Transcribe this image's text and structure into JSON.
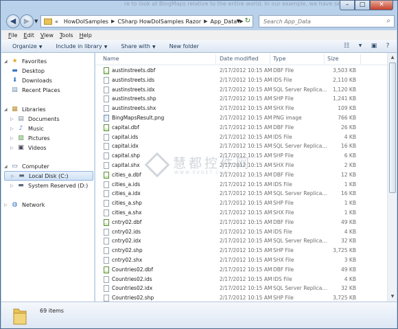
{
  "window": {
    "background_text": "re to look at BingMaps relative to the entire world. In our example, we have set BingMaps"
  },
  "address_bar": {
    "overflow_marker": "«",
    "breadcrumbs": [
      "HowDoISamples",
      "CSharp HowDoISamples Razor",
      "App_Data"
    ]
  },
  "search": {
    "placeholder": "Search App_Data"
  },
  "menu": {
    "items": [
      {
        "accel": "F",
        "rest": "ile"
      },
      {
        "accel": "E",
        "rest": "dit"
      },
      {
        "accel": "V",
        "rest": "iew"
      },
      {
        "accel": "T",
        "rest": "ools"
      },
      {
        "accel": "H",
        "rest": "elp"
      }
    ]
  },
  "toolbar": {
    "organize": "Organize",
    "include": "Include in library",
    "share": "Share with",
    "new_folder": "New folder"
  },
  "nav": {
    "favorites": "Favorites",
    "desktop": "Desktop",
    "downloads": "Downloads",
    "recent": "Recent Places",
    "libraries": "Libraries",
    "documents": "Documents",
    "music": "Music",
    "pictures": "Pictures",
    "videos": "Videos",
    "computer": "Computer",
    "local_disk": "Local Disk (C:)",
    "system_reserved": "System Reserved (D:)",
    "network": "Network"
  },
  "columns": {
    "name": "Name",
    "date": "Date modified",
    "type": "Type",
    "size": "Size"
  },
  "files": [
    {
      "name": "austinstreets.dbf",
      "date": "2/17/2012 10:15 AM",
      "type": "DBF File",
      "size": "3,503 KB",
      "icon": "dbf"
    },
    {
      "name": "austinstreets.ids",
      "date": "2/17/2012 10:15 AM",
      "type": "IDS File",
      "size": "2,110 KB",
      "icon": "file"
    },
    {
      "name": "austinstreets.idx",
      "date": "2/17/2012 10:15 AM",
      "type": "SQL Server Replica...",
      "size": "1,120 KB",
      "icon": "file"
    },
    {
      "name": "austinstreets.shp",
      "date": "2/17/2012 10:15 AM",
      "type": "SHP File",
      "size": "1,241 KB",
      "icon": "file"
    },
    {
      "name": "austinstreets.shx",
      "date": "2/17/2012 10:15 AM",
      "type": "SHX File",
      "size": "109 KB",
      "icon": "file"
    },
    {
      "name": "BingMapsResult.png",
      "date": "2/17/2012 10:15 AM",
      "type": "PNG image",
      "size": "766 KB",
      "icon": "img"
    },
    {
      "name": "capital.dbf",
      "date": "2/17/2012 10:15 AM",
      "type": "DBF File",
      "size": "26 KB",
      "icon": "dbf"
    },
    {
      "name": "capital.ids",
      "date": "2/17/2012 10:15 AM",
      "type": "IDS File",
      "size": "4 KB",
      "icon": "file"
    },
    {
      "name": "capital.idx",
      "date": "2/17/2012 10:15 AM",
      "type": "SQL Server Replica...",
      "size": "16 KB",
      "icon": "file"
    },
    {
      "name": "capital.shp",
      "date": "2/17/2012 10:15 AM",
      "type": "SHP File",
      "size": "6 KB",
      "icon": "file"
    },
    {
      "name": "capital.shx",
      "date": "2/17/2012 10:15 AM",
      "type": "SHX File",
      "size": "2 KB",
      "icon": "file"
    },
    {
      "name": "cities_a.dbf",
      "date": "2/17/2012 10:15 AM",
      "type": "DBF File",
      "size": "12 KB",
      "icon": "dbf"
    },
    {
      "name": "cities_a.ids",
      "date": "2/17/2012 10:15 AM",
      "type": "IDS File",
      "size": "1 KB",
      "icon": "file"
    },
    {
      "name": "cities_a.idx",
      "date": "2/17/2012 10:15 AM",
      "type": "SQL Server Replica...",
      "size": "16 KB",
      "icon": "file"
    },
    {
      "name": "cities_a.shp",
      "date": "2/17/2012 10:15 AM",
      "type": "SHP File",
      "size": "1 KB",
      "icon": "file"
    },
    {
      "name": "cities_a.shx",
      "date": "2/17/2012 10:15 AM",
      "type": "SHX File",
      "size": "1 KB",
      "icon": "file"
    },
    {
      "name": "cntry02.dbf",
      "date": "2/17/2012 10:15 AM",
      "type": "DBF File",
      "size": "49 KB",
      "icon": "dbf"
    },
    {
      "name": "cntry02.ids",
      "date": "2/17/2012 10:15 AM",
      "type": "IDS File",
      "size": "4 KB",
      "icon": "file"
    },
    {
      "name": "cntry02.idx",
      "date": "2/17/2012 10:15 AM",
      "type": "SQL Server Replica...",
      "size": "32 KB",
      "icon": "file"
    },
    {
      "name": "cntry02.shp",
      "date": "2/17/2012 10:15 AM",
      "type": "SHP File",
      "size": "3,725 KB",
      "icon": "file"
    },
    {
      "name": "cntry02.shx",
      "date": "2/17/2012 10:15 AM",
      "type": "SHX File",
      "size": "3 KB",
      "icon": "file"
    },
    {
      "name": "Countries02.dbf",
      "date": "2/17/2012 10:15 AM",
      "type": "DBF File",
      "size": "49 KB",
      "icon": "dbf"
    },
    {
      "name": "Countries02.ids",
      "date": "2/17/2012 10:15 AM",
      "type": "IDS File",
      "size": "4 KB",
      "icon": "file"
    },
    {
      "name": "Countries02.idx",
      "date": "2/17/2012 10:15 AM",
      "type": "SQL Server Replica...",
      "size": "32 KB",
      "icon": "file"
    },
    {
      "name": "Countries02.shp",
      "date": "2/17/2012 10:15 AM",
      "type": "SHP File",
      "size": "3,725 KB",
      "icon": "file"
    }
  ],
  "details": {
    "item_count": "69 items"
  },
  "watermark": {
    "main": "慧都控件网",
    "sub": "WWW.EVGET.COM"
  },
  "colors": {
    "window_frame": "#b9d1ea",
    "selection": "#cfe2f6",
    "folder": "#e8c45b",
    "dbf_icon": "#5b8c3a"
  }
}
